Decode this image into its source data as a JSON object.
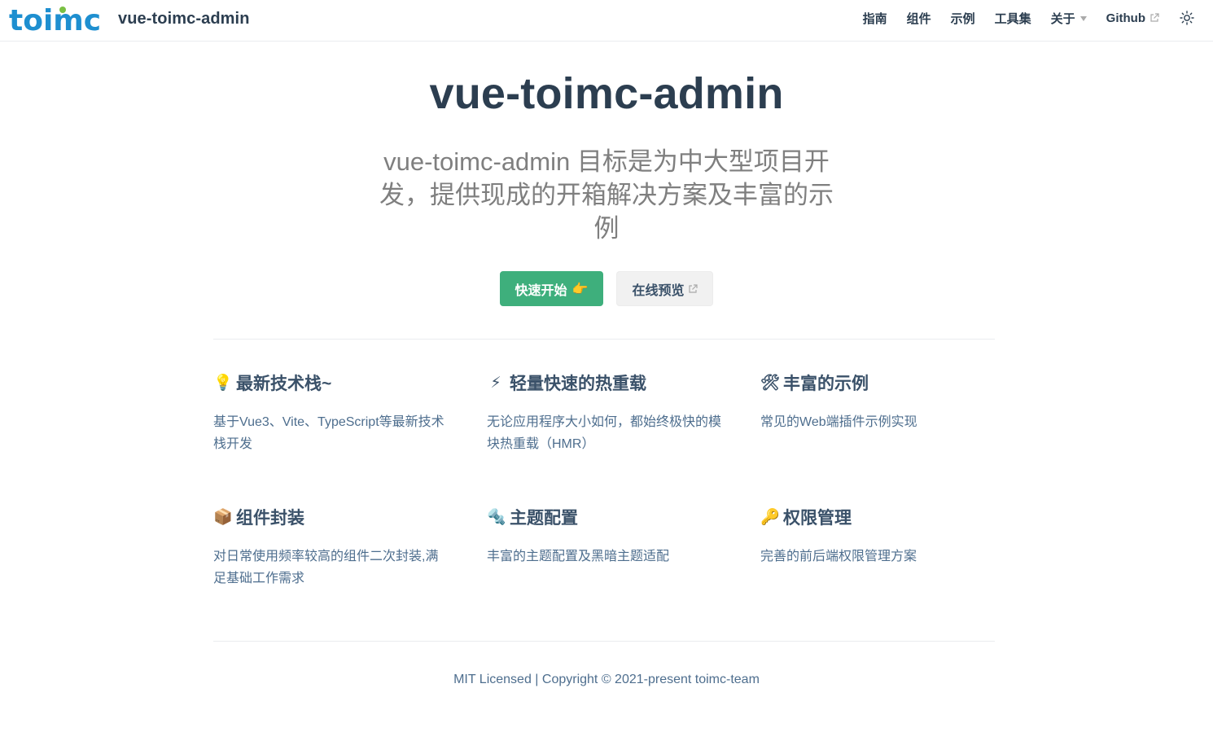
{
  "navbar": {
    "logo_text": "toimc",
    "site_name": "vue-toimc-admin",
    "links": [
      {
        "label": "指南"
      },
      {
        "label": "组件"
      },
      {
        "label": "示例"
      },
      {
        "label": "工具集"
      },
      {
        "label": "关于"
      },
      {
        "label": "Github"
      }
    ],
    "theme_toggle_icon": "sun-icon"
  },
  "hero": {
    "title": "vue-toimc-admin",
    "description": "vue-toimc-admin 目标是为中大型项目开发，提供现成的开箱解决方案及丰富的示例",
    "primary_action": {
      "label": "快速开始",
      "emoji": "👉"
    },
    "secondary_action": {
      "label": "在线预览",
      "icon": "external-link-icon"
    }
  },
  "features": [
    {
      "emoji": "💡",
      "title": "最新技术栈~",
      "details": "基于Vue3、Vite、TypeScript等最新技术栈开发"
    },
    {
      "emoji": "⚡",
      "title": "轻量快速的热重载",
      "details": "无论应用程序大小如何，都始终极快的模块热重载（HMR）"
    },
    {
      "emoji": "🛠",
      "title": "丰富的示例",
      "details": "常见的Web端插件示例实现"
    },
    {
      "emoji": "📦",
      "title": "组件封装",
      "details": "对日常使用频率较高的组件二次封装,满足基础工作需求"
    },
    {
      "emoji": "🔩",
      "title": "主题配置",
      "details": "丰富的主题配置及黑暗主题适配"
    },
    {
      "emoji": "🔑",
      "title": "权限管理",
      "details": "完善的前后端权限管理方案"
    }
  ],
  "footer": {
    "text": "MIT Licensed | Copyright © 2021-present toimc-team"
  },
  "colors": {
    "accent": "#3eaf7c",
    "text": "#2c3e50",
    "muted": "#4e6e8e"
  }
}
